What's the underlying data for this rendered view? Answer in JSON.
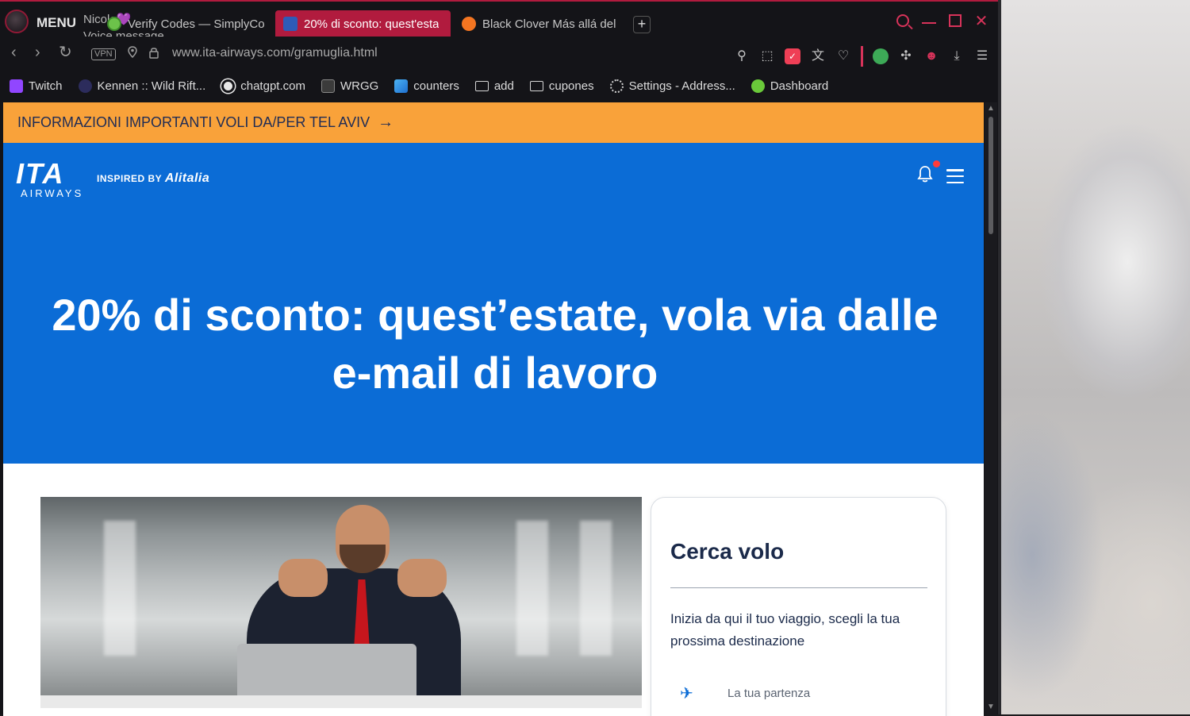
{
  "menu": {
    "label": "MENU"
  },
  "notification": {
    "sender": "Nicole",
    "heart": "💜",
    "text": "Voice message"
  },
  "tabs": [
    {
      "title": "Verify Codes — SimplyCo",
      "icon": "verify-icon"
    },
    {
      "title": "20% di sconto: quest'esta",
      "icon": "ita-favicon",
      "active": true
    },
    {
      "title": "Black Clover Más allá del",
      "icon": "crunchyroll-icon"
    }
  ],
  "new_tab": "+",
  "address": {
    "vpn": "VPN",
    "url": "www.ita-airways.com/gramuglia.html"
  },
  "bookmarks": [
    {
      "label": "Twitch",
      "icon": "twitch-icon"
    },
    {
      "label": "Kennen :: Wild Rift...",
      "icon": "kennen-icon"
    },
    {
      "label": "chatgpt.com",
      "icon": "chatgpt-icon"
    },
    {
      "label": "WRGG",
      "icon": "wrgg-icon"
    },
    {
      "label": "counters",
      "icon": "counters-icon"
    },
    {
      "label": "add",
      "icon": "folder-icon"
    },
    {
      "label": "cupones",
      "icon": "folder-icon"
    },
    {
      "label": "Settings - Address...",
      "icon": "gear-icon"
    },
    {
      "label": "Dashboard",
      "icon": "dashboard-icon"
    }
  ],
  "page": {
    "alert": "INFORMAZIONI IMPORTANTI VOLI DA/PER TEL AVIV",
    "logo": {
      "brand": "ITA",
      "sub": "AIRWAYS",
      "inspired": "INSPIRED BY",
      "alitalia": "Alitalia"
    },
    "title": "20% di sconto: quest’estate, vola via dalle e-mail di lavoro",
    "search_card": {
      "title": "Cerca volo",
      "description": "Inizia da qui il tuo viaggio, scegli la tua prossima destinazione",
      "departure_placeholder": "La tua partenza"
    }
  },
  "colors": {
    "accent": "#b11b3e",
    "banner": "#f9a23a",
    "hero": "#0b6cd6",
    "navy": "#1b2a4a"
  }
}
